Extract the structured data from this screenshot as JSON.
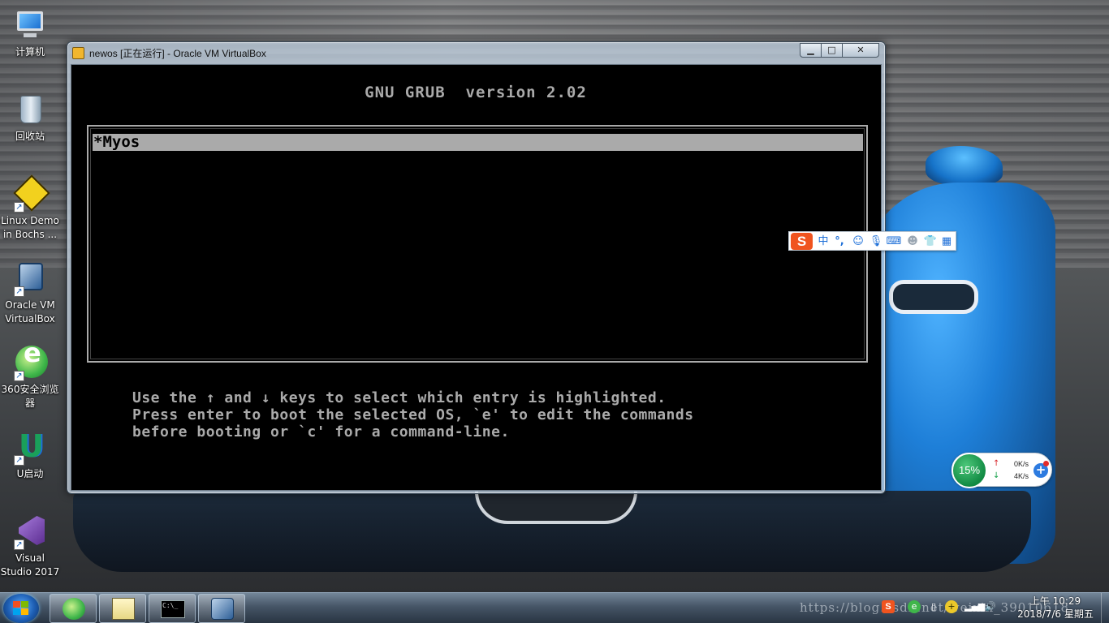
{
  "desktop": {
    "icons": [
      {
        "label": "计算机"
      },
      {
        "label": "回收站"
      },
      {
        "label": "Linux Demo\nin Bochs ..."
      },
      {
        "label": "Oracle VM\nVirtualBox"
      },
      {
        "label": "360安全浏览\n器"
      },
      {
        "label": "U启动"
      },
      {
        "label": "Visual\nStudio 2017"
      }
    ]
  },
  "vbox_window": {
    "title": "newos [正在运行] - Oracle VM VirtualBox",
    "buttons": {
      "minimize": "▁",
      "maximize": "□",
      "close": "✕"
    }
  },
  "grub": {
    "header": "GNU GRUB  version 2.02",
    "entries": [
      {
        "label": "*Myos",
        "selected": true
      }
    ],
    "help": "Use the ↑ and ↓ keys to select which entry is highlighted.\nPress enter to boot the selected OS, `e' to edit the commands\nbefore booting or `c' for a command-line."
  },
  "ime": {
    "logo": "S",
    "mode": "中",
    "punct": "°,",
    "icons": [
      "emoji-icon",
      "mic-icon",
      "keyboard-icon",
      "user-icon",
      "shirt-icon",
      "grid-icon"
    ]
  },
  "netmon": {
    "cpu": "15%",
    "up": "0K/s",
    "down": "4K/s"
  },
  "taskbar": {
    "items": [
      "360-browser",
      "notepad",
      "cmd",
      "virtualbox"
    ],
    "cmd_text": "C:\\_",
    "watermark": "https://blog.csdn.net/weixin_39010618",
    "clock_time": "上午 10:29",
    "clock_date": "2018/7/6 星期五"
  },
  "colors": {
    "grub_fg": "#aaaaaa",
    "grub_bg": "#000000",
    "sogou": "#f0541f",
    "cpu_green": "#118a43"
  }
}
